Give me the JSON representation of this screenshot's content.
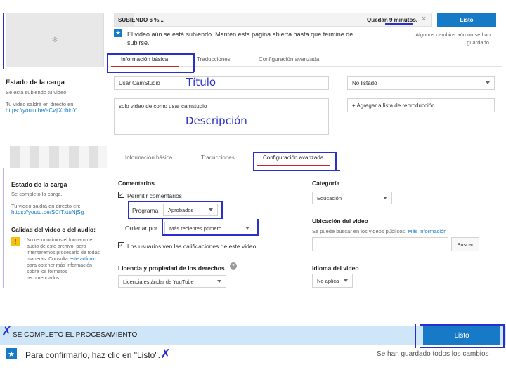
{
  "top": {
    "upload_status": "SUBIENDO 6 %...",
    "time_left": "Quedan 9 minutos.",
    "close_symbol": "×",
    "done_button": "Listo",
    "notice": "El video aún se está subiendo. Mantén esta página abierta hasta que termine de subirse.",
    "saved_note": "Algunos cambios aún no se han guardado.",
    "tabs": [
      "Información básica",
      "Traducciones",
      "Configuración avanzada"
    ],
    "upload_state_title": "Estado de la carga",
    "upload_state_text": "Se está subiendo tu video.",
    "video_available_label": "Tu video saldrá en directo en:",
    "video_url": "https://youtu.be/eCvjIXobioY",
    "title_value": "Usar CamStudio",
    "title_annotation": "Título",
    "description_value": "solo video de como usar camstudio",
    "description_annotation": "Descripción",
    "privacy_value": "No listado",
    "playlist_button": "+ Agregar a lista de reproducción"
  },
  "middle": {
    "tabs": [
      "Información básica",
      "Traducciones",
      "Configuración avanzada"
    ],
    "upload_state_title": "Estado de la carga",
    "upload_state_text": "Se completó la carga.",
    "video_available_label": "Tu video saldrá en directo en:",
    "video_url": "https://youtu.be/SCtTxtuNjSg",
    "quality_title": "Calidad del video o del audio:",
    "quality_text": "No reconocimos el formato de audio de este archivo, pero intentaremos procesarlo de todas maneras. Consulta",
    "quality_link": "este artículo",
    "quality_text_after": "para obtener más información sobre los formatos recomendados.",
    "comments_title": "Comentarios",
    "allow_comments": "Permitir comentarios",
    "program_label": "Programa",
    "program_value": "Aprobados",
    "sort_label": "Ordenar por",
    "sort_value": "Más recientes primero",
    "ratings_label": "Los usuarios ven las calificaciones de este video.",
    "license_title": "Licencia y propiedad de los derechos",
    "license_value": "Licencia estándar de YouTube",
    "category_title": "Categoría",
    "category_value": "Educación",
    "location_title": "Ubicación del video",
    "location_text": "Se puede buscar en los videos públicos.",
    "location_link": "Más información",
    "search_button": "Buscar",
    "language_title": "Idioma del video",
    "language_value": "No aplica",
    "help_symbol": "?"
  },
  "bottom": {
    "processing_status": "SE COMPLETÓ EL PROCESAMIENTO",
    "done_button": "Listo",
    "confirm_text": "Para confirmarlo, haz clic en \"Listo\".",
    "saved_text": "Se han guardado todos los cambios"
  },
  "colors": {
    "accent": "#167ac6",
    "annotation": "#2a2fd0",
    "processing_bar": "#cfe6f8"
  }
}
